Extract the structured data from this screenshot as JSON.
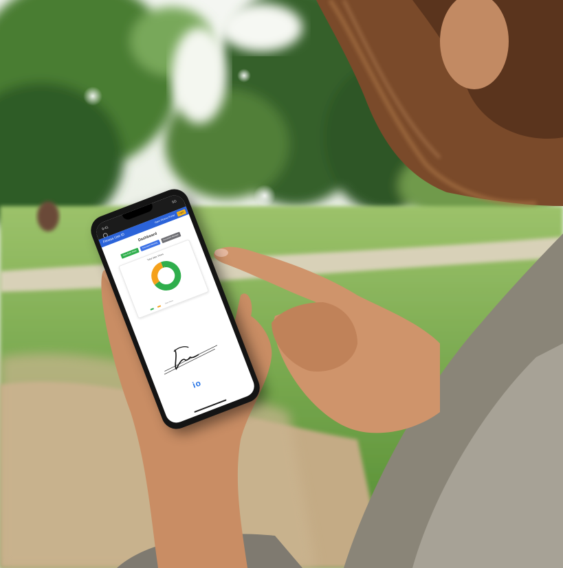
{
  "scene": {
    "description_colors": {
      "sky": "#eef2ec",
      "trees": "#3d6a2e",
      "grass": "#5f9a3a",
      "path": "#c9b38f",
      "hair": "#7a4a2a",
      "skin": "#c98d64",
      "sweater": "#8a8578"
    }
  },
  "phone_app": {
    "status_left": "9:41",
    "status_right": "5G",
    "app_title": "Fitness Use ID",
    "top_link": "Open Fitness Portal",
    "top_button": "Login",
    "dashboard_title": "Dashboard",
    "buttons": [
      "Data Entry Mode",
      "Document Vending",
      "Document Manage"
    ],
    "card_title": "Total data Views",
    "legend_text": "Data Views",
    "logo_text": "io",
    "colors": {
      "accent_blue": "#2b63d9",
      "green": "#2fae4c",
      "orange": "#f5a11b",
      "gray_button": "#6e6e73"
    }
  },
  "chart_data": {
    "type": "pie",
    "title": "Total data Views",
    "series": [
      {
        "values": [
          70,
          30
        ]
      }
    ],
    "colors": [
      "#2fae4c",
      "#f5a11b"
    ]
  }
}
